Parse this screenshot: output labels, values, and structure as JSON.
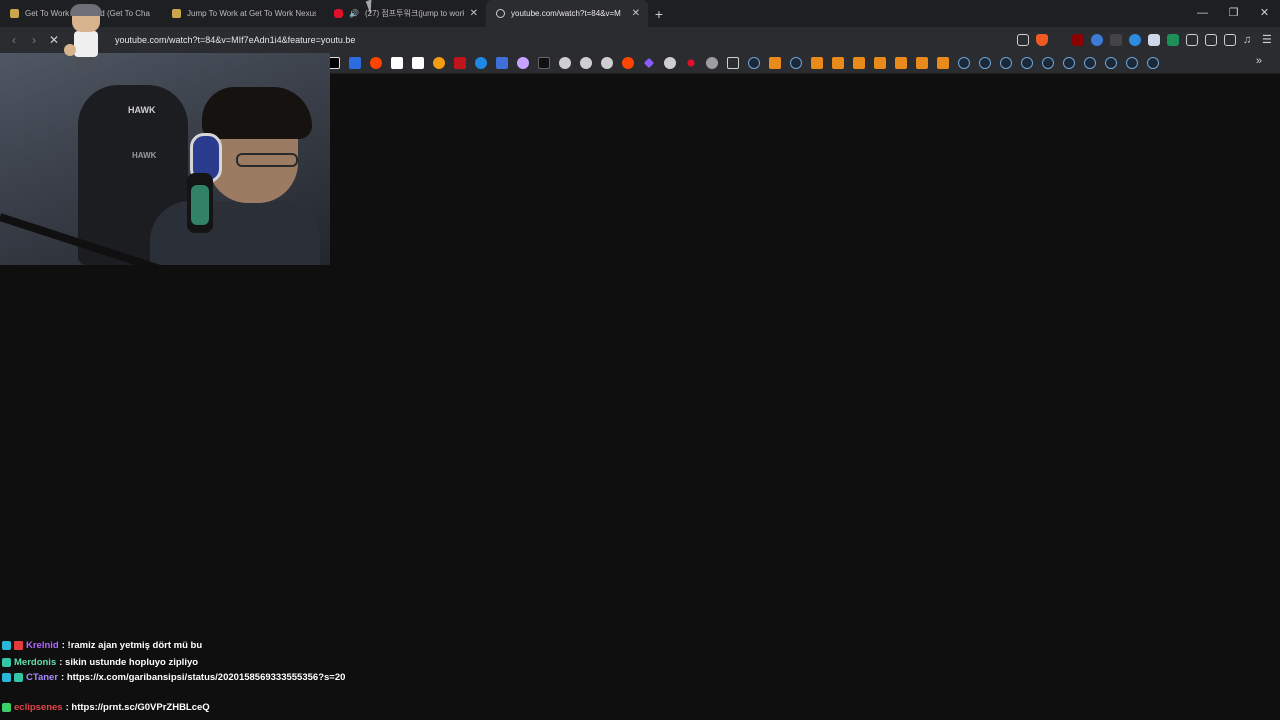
{
  "tabs": [
    {
      "title": "Get To Work Collected (Get To Cha",
      "favicon": "gtw-icon",
      "active": false
    },
    {
      "title": "Jump To Work at Get To Work Nexus",
      "favicon": "gtw-icon",
      "active": false
    },
    {
      "title": "(27) 점프투워크(jump to work",
      "favicon": "youtube-icon",
      "active": false,
      "audio": true
    },
    {
      "title": "youtube.com/watch?t=84&v=M",
      "favicon": "globe-icon",
      "active": true
    }
  ],
  "window_controls": {
    "minimize": "—",
    "restore": "❐",
    "close": "✕"
  },
  "address": {
    "url": "youtube.com/watch?t=84&v=MIf7eAdn1i4&feature=youtu.be"
  },
  "chat": [
    {
      "user": "Krelnid",
      "message": ": !ramiz ajan yetmiş dört mü bu",
      "badges": [
        "cyan",
        "red"
      ],
      "color": "#b266ff"
    },
    {
      "user": "Merdonis",
      "message": ": sikin ustunde hopluyo zipliyo",
      "badges": [
        "teal"
      ],
      "color": "#5fe0a8"
    },
    {
      "user": "CTaner",
      "message": ": https://x.com/garibansipsi/status/2020158569333555356?s=20",
      "badges": [
        "cyan",
        "teal"
      ],
      "color": "#a98bff"
    },
    {
      "user": "eclipsenes",
      "message": ": https://prnt.sc/G0VPrZHBLceQ",
      "badges": [
        "green"
      ],
      "color": "#e14545"
    }
  ],
  "webcam": {
    "chair_brand": "HAWK"
  },
  "colors": {
    "background": "#0f0f10",
    "toolbar": "#2b2c30",
    "tabstrip": "#1e1f22"
  }
}
